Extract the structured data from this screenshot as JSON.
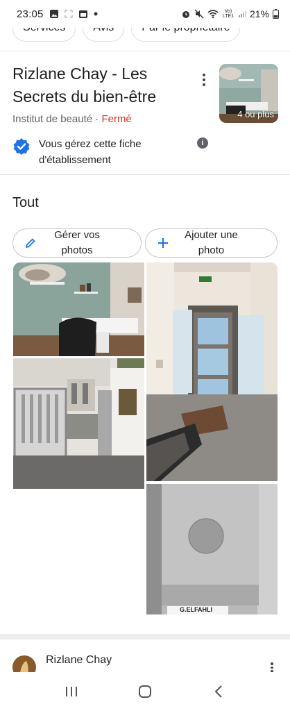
{
  "status_bar": {
    "time": "23:05",
    "battery": "21%",
    "network": "Vo) LTE1"
  },
  "chips": [
    "Services",
    "Avis",
    "Par le propriétaire"
  ],
  "business": {
    "title": "Rizlane Chay - Les Secrets du bien-être",
    "category": "Institut de beauté",
    "separator": " · ",
    "status": "Fermé",
    "thumb_label": "4 ou plus",
    "manage_text": "Vous gérez cette fiche d'établissement"
  },
  "photos_section": {
    "title": "Tout",
    "manage_photos_label": "Gérer vos photos",
    "add_photo_label": "Ajouter une photo",
    "name_plate_text": "G.ELFAHLI"
  },
  "review": {
    "reviewer_name": "Rizlane Chay"
  },
  "colors": {
    "accent": "#1a73e8",
    "closed": "#d93025",
    "verified": "#1a73e8"
  },
  "icons": [
    "gallery-icon",
    "screenshot-icon",
    "calendar-icon",
    "alarm-icon",
    "mute-icon",
    "wifi-icon",
    "signal-icon",
    "battery-icon",
    "more-vert-icon",
    "verified-icon",
    "info-icon",
    "pencil-icon",
    "plus-icon",
    "recent-apps-icon",
    "home-icon",
    "back-icon"
  ]
}
